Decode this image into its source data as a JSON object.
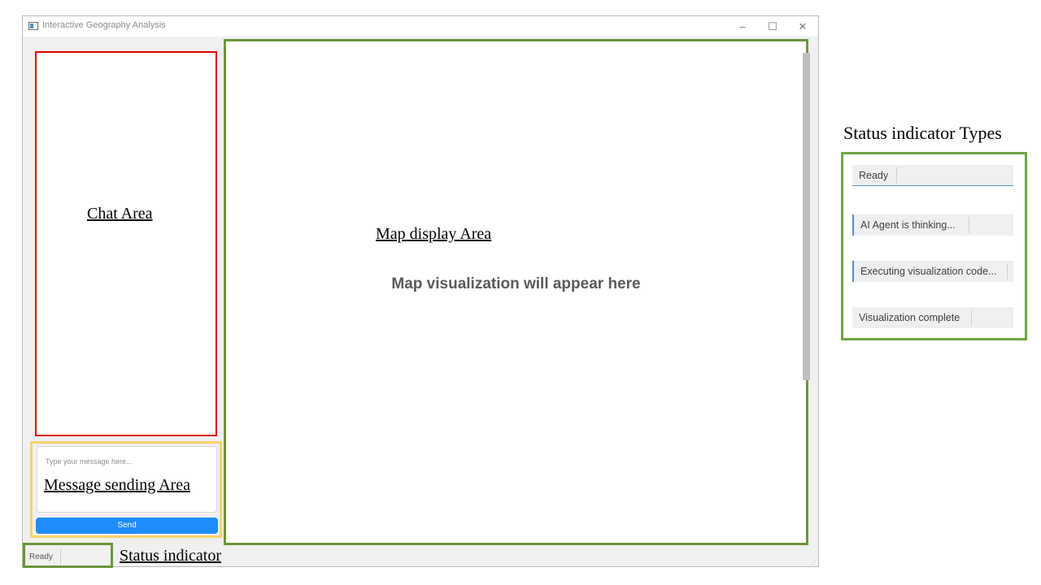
{
  "window": {
    "title": "Interactive Geography Analysis",
    "minimize_glyph": "–",
    "maximize_glyph": "☐",
    "close_glyph": "✕"
  },
  "chat": {
    "annotation": "Chat Area"
  },
  "message": {
    "placeholder": "Type your message here...",
    "annotation": "Message sending Area",
    "send_label": "Send"
  },
  "map": {
    "annotation": "Map display Area",
    "placeholder": "Map visualization will appear here"
  },
  "status_bar": {
    "text": "Ready",
    "annotation": "Status indicator"
  },
  "status_types": {
    "heading": "Status indicator Types",
    "items": [
      "Ready",
      "AI Agent is thinking...",
      "Executing visualization code...",
      "Visualization complete"
    ]
  },
  "colors": {
    "chat_outline": "#e00000",
    "message_outline": "#f5d56a",
    "map_outline": "#69963a",
    "send_button": "#1e8cfa"
  }
}
